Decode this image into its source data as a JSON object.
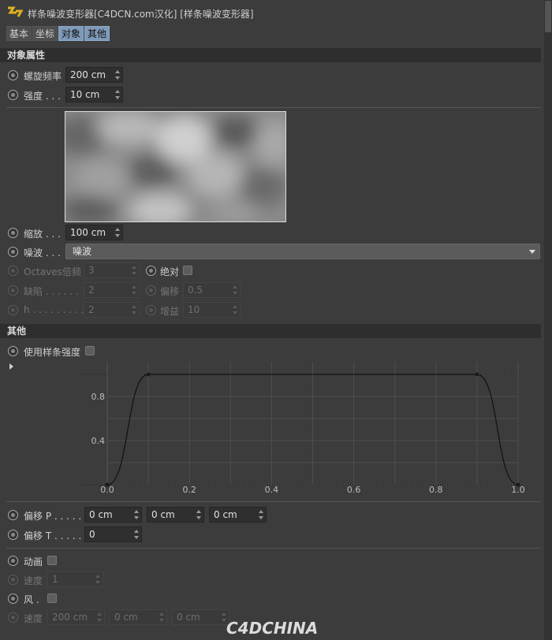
{
  "window": {
    "title": "样条噪波变形器[C4DCN.com汉化] [样条噪波变形器]"
  },
  "tabs": [
    {
      "label": "基本",
      "active": false
    },
    {
      "label": "坐标",
      "active": false
    },
    {
      "label": "对象",
      "active": true
    },
    {
      "label": "其他",
      "active": true
    }
  ],
  "object_section": {
    "header": "对象属性",
    "spiral_freq": {
      "label": "螺旋频率",
      "value": "200 cm"
    },
    "strength": {
      "label": "强度 . . .",
      "value": "10 cm"
    },
    "scale": {
      "label": "缩放 . . .",
      "value": "100 cm"
    },
    "noise": {
      "label": "噪波 . . .",
      "value": "噪波"
    },
    "octaves": {
      "label": "Octaves倍频",
      "value": "3"
    },
    "absolute": {
      "label": "绝对"
    },
    "lacunarity": {
      "label": "缺陷 . . . . . .",
      "value": "2"
    },
    "offset": {
      "label": "偏移",
      "value": "0.5"
    },
    "h": {
      "label": "h . . . . . . . . .",
      "value": "2"
    },
    "gain": {
      "label": "增益",
      "value": "10"
    }
  },
  "other_section": {
    "header": "其他",
    "use_spline_strength": {
      "label": "使用样条强度"
    },
    "offset_p": {
      "label": "偏移 P . . . . . .",
      "values": [
        "0 cm",
        "0 cm",
        "0 cm"
      ]
    },
    "offset_t": {
      "label": "偏移 T . . . . . .",
      "value": "0"
    },
    "animate": {
      "label": "动画"
    },
    "speed1": {
      "label": "速度",
      "value": "1"
    },
    "wind": {
      "label": "风 ."
    },
    "speed2": {
      "label": "速度",
      "values": [
        "200 cm",
        "0 cm",
        "0 cm"
      ]
    }
  },
  "chart_data": {
    "type": "line",
    "xlim": [
      0,
      1
    ],
    "ylim": [
      0,
      1
    ],
    "x_ticks": [
      "0.0",
      "0.2",
      "0.4",
      "0.6",
      "0.8",
      "1.0"
    ],
    "y_ticks": [
      "0.4",
      "0.8"
    ],
    "grid": true,
    "points": [
      {
        "x": 0.0,
        "y": 0.0
      },
      {
        "x": 0.1,
        "y": 1.0
      },
      {
        "x": 0.9,
        "y": 1.0
      },
      {
        "x": 1.0,
        "y": 0.0
      }
    ]
  },
  "watermark": "C4DCHINA",
  "colors": {
    "accent": "#7f99b8",
    "background": "#3c3c3c"
  }
}
